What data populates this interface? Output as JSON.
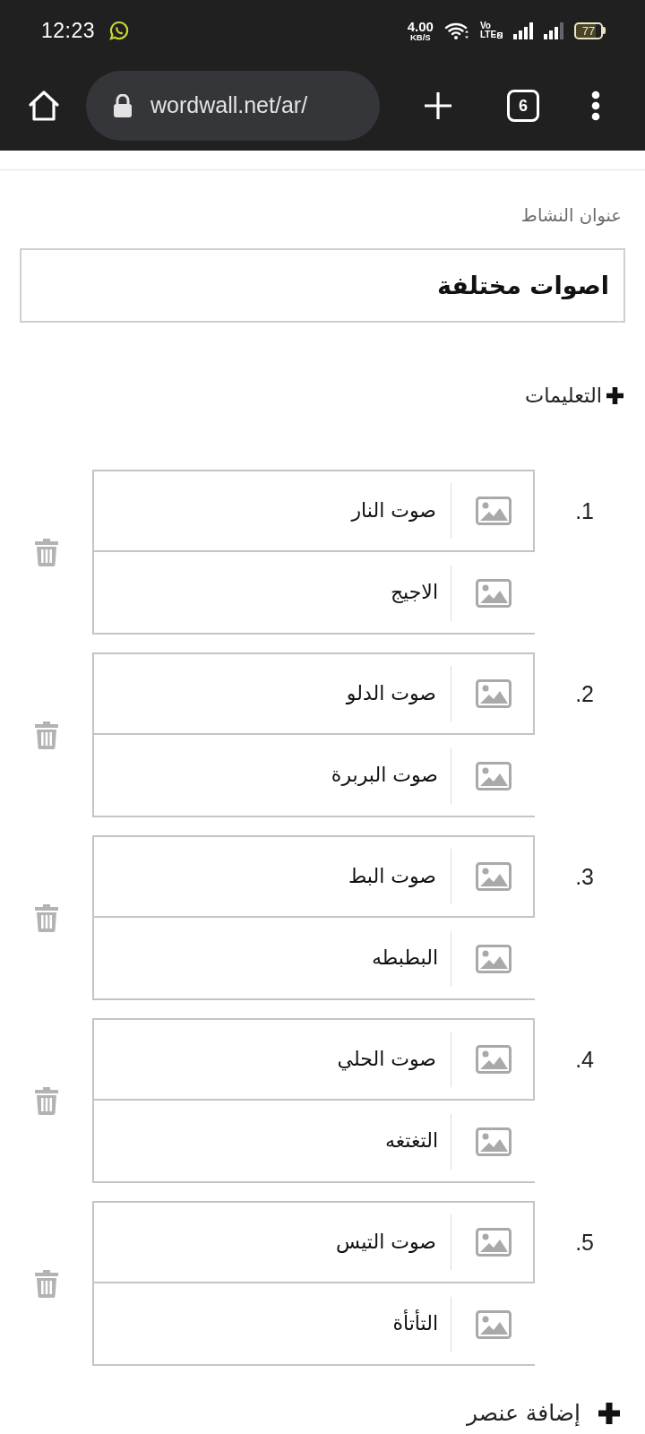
{
  "status_bar": {
    "time": "12:23",
    "net_speed": "4.00",
    "net_speed_unit": "KB/S",
    "volte": "Vo",
    "volte_network": "LTE",
    "sim_slot": "2",
    "battery": "77"
  },
  "browser_toolbar": {
    "url": "wordwall.net/ar/",
    "tab_count": "6"
  },
  "activity_title": {
    "label": "عنوان النشاط",
    "value": "اصوات مختلفة"
  },
  "instructions_link": "التعليمات",
  "items": [
    {
      "number": "1.",
      "prompt": "صوت النار",
      "answer": "الاجيج"
    },
    {
      "number": "2.",
      "prompt": "صوت الدلو",
      "answer": "صوت البربرة"
    },
    {
      "number": "3.",
      "prompt": "صوت البط",
      "answer": "البطبطه"
    },
    {
      "number": "4.",
      "prompt": "صوت الحلي",
      "answer": "التغتغه"
    },
    {
      "number": "5.",
      "prompt": "صوت التيس",
      "answer": "التأتأة"
    }
  ],
  "add_item_link": "إضافة عنصر"
}
